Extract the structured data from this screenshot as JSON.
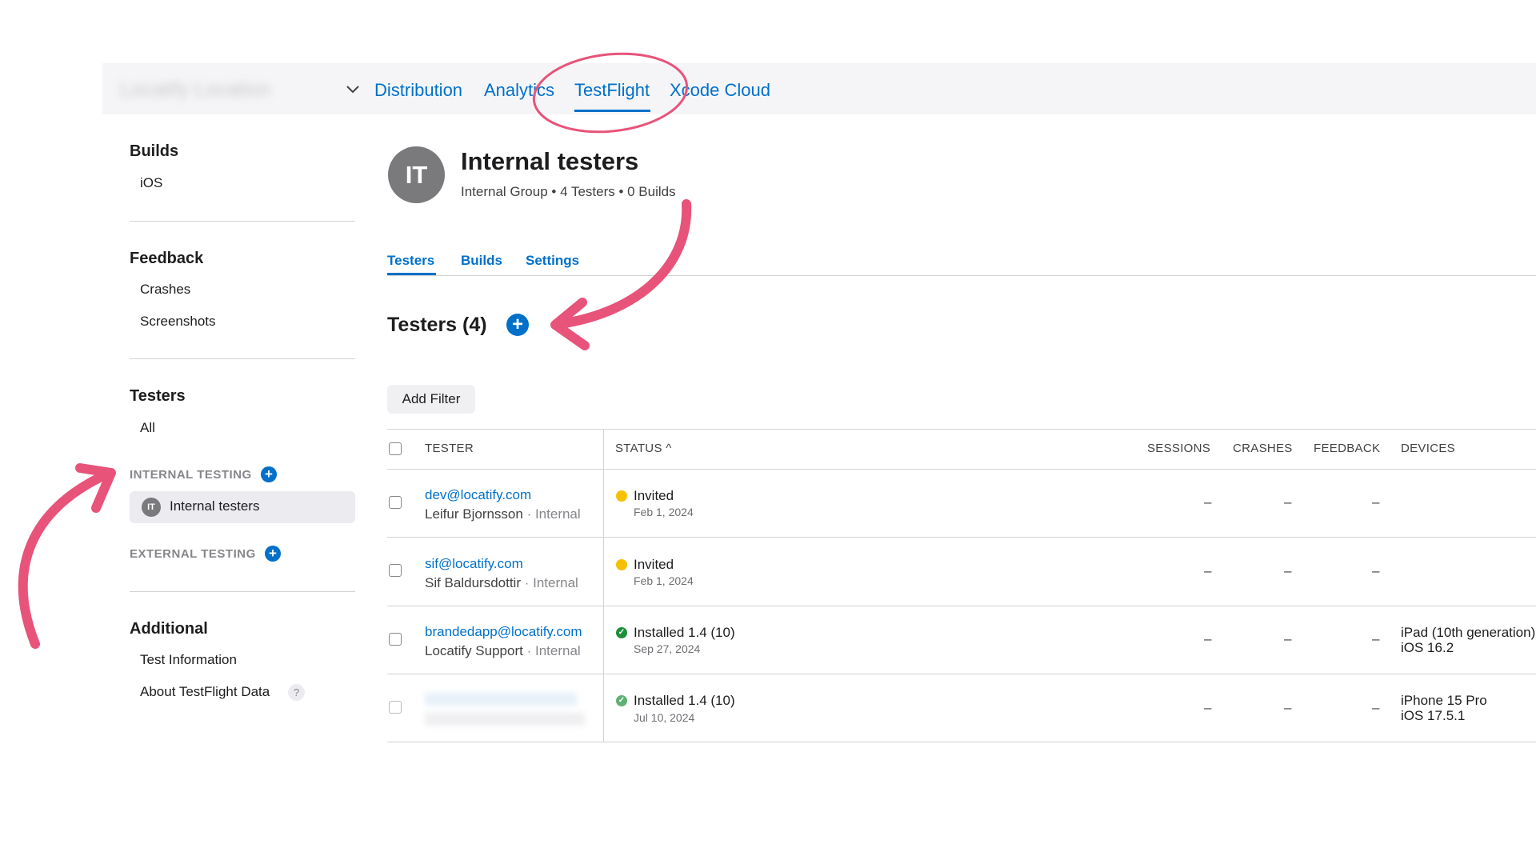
{
  "topnav": {
    "app_name": "Locatify Location",
    "items": [
      "Distribution",
      "Analytics",
      "TestFlight",
      "Xcode Cloud"
    ],
    "active": "TestFlight"
  },
  "sidebar": {
    "builds": {
      "heading": "Builds",
      "items": [
        "iOS"
      ]
    },
    "feedback": {
      "heading": "Feedback",
      "items": [
        "Crashes",
        "Screenshots"
      ]
    },
    "testers": {
      "heading": "Testers",
      "items": [
        "All"
      ]
    },
    "internal_testing": {
      "label": "INTERNAL TESTING",
      "groups": [
        {
          "initials": "IT",
          "name": "Internal testers"
        }
      ]
    },
    "external_testing": {
      "label": "EXTERNAL TESTING"
    },
    "additional": {
      "heading": "Additional",
      "items": [
        "Test Information",
        "About TestFlight Data"
      ],
      "help": "?"
    }
  },
  "header": {
    "avatar_initials": "IT",
    "title": "Internal testers",
    "subtitle": "Internal Group • 4 Testers • 0 Builds"
  },
  "tabs": [
    "Testers",
    "Builds",
    "Settings"
  ],
  "section": {
    "title": "Testers (4)"
  },
  "filter_button": "Add Filter",
  "table": {
    "headers": {
      "tester": "TESTER",
      "status": "STATUS ^",
      "sessions": "SESSIONS",
      "crashes": "CRASHES",
      "feedback": "FEEDBACK",
      "devices": "DEVICES"
    },
    "rows": [
      {
        "email": "dev@locatify.com",
        "name": "Leifur Bjornsson",
        "group": "· Internal",
        "status": "Invited",
        "status_color": "yellow",
        "date": "Feb 1, 2024",
        "sessions": "–",
        "crashes": "–",
        "feedback": "–",
        "device": "",
        "os": ""
      },
      {
        "email": "sif@locatify.com",
        "name": "Sif Baldursdottir",
        "group": "· Internal",
        "status": "Invited",
        "status_color": "yellow",
        "date": "Feb 1, 2024",
        "sessions": "–",
        "crashes": "–",
        "feedback": "–",
        "device": "",
        "os": ""
      },
      {
        "email": "brandedapp@locatify.com",
        "name": "Locatify Support",
        "group": "· Internal",
        "status": "Installed 1.4 (10)",
        "status_color": "green",
        "date": "Sep 27, 2024",
        "sessions": "–",
        "crashes": "–",
        "feedback": "–",
        "device": "iPad (10th generation)",
        "os": "iOS 16.2"
      },
      {
        "email": "",
        "name": "",
        "group": "",
        "status": "Installed 1.4 (10)",
        "status_color": "green",
        "date": "Jul 10, 2024",
        "sessions": "–",
        "crashes": "–",
        "feedback": "–",
        "device": "iPhone 15 Pro",
        "os": "iOS 17.5.1"
      }
    ]
  },
  "colors": {
    "accent": "#0070c9",
    "annotation": "#e8537a",
    "invited": "#f6bf00",
    "installed": "#1d8f3b"
  }
}
